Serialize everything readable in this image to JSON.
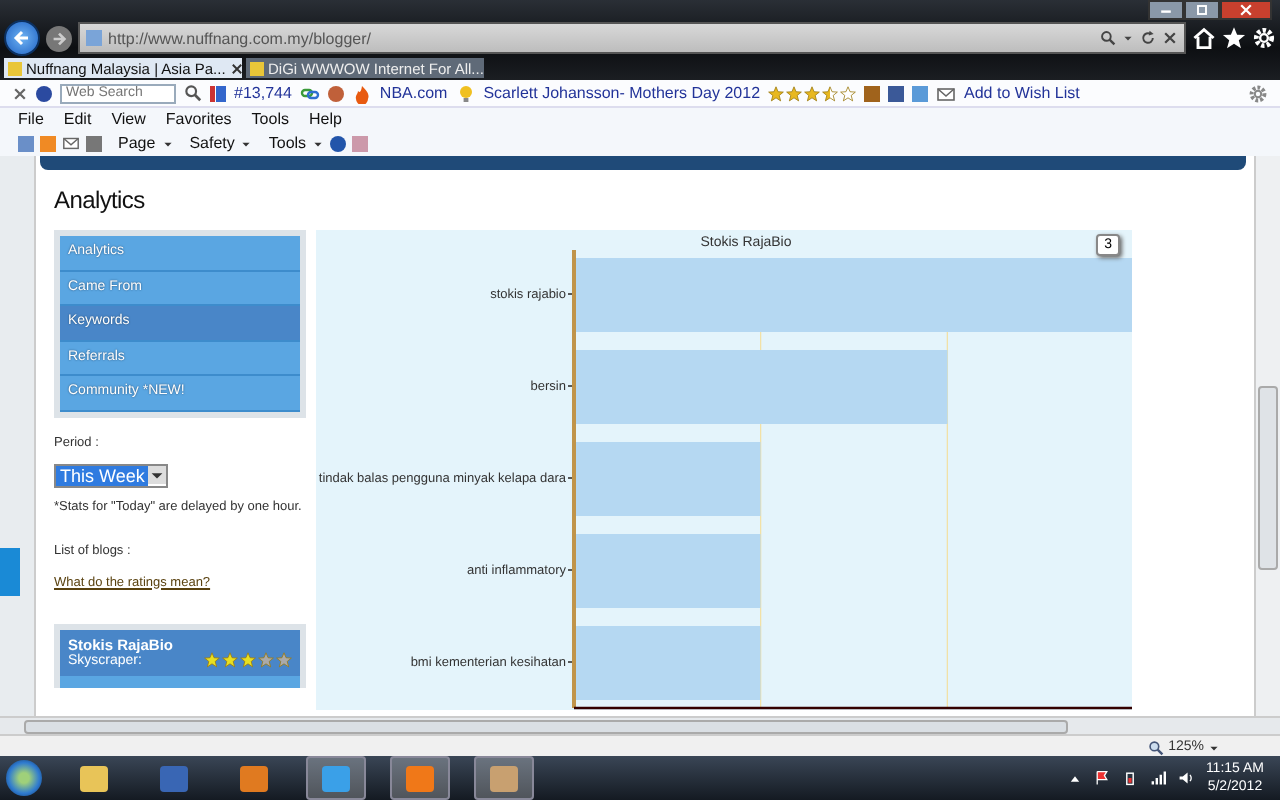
{
  "browser": {
    "address": "http://www.nuffnang.com.my/blogger/",
    "tabs": [
      {
        "label": "Nuffnang Malaysia | Asia Pa...",
        "selected": true
      },
      {
        "label": "DiGi WWWOW Internet For All...",
        "selected": false
      }
    ]
  },
  "toolbar": {
    "search_placeholder": "Web Search",
    "rank": "#13,744",
    "site_link": "NBA.com",
    "news_link": "Scarlett Johansson- Mothers Day 2012",
    "stars": 3.5,
    "wish_list": "Add to Wish List"
  },
  "menu": [
    "File",
    "Edit",
    "View",
    "Favorites",
    "Tools",
    "Help"
  ],
  "command_bar": [
    "Page",
    "Safety",
    "Tools"
  ],
  "page": {
    "heading": "Analytics",
    "nav": [
      {
        "label": "Analytics",
        "selected": false
      },
      {
        "label": "Came From",
        "selected": false
      },
      {
        "label": "Keywords",
        "selected": true
      },
      {
        "label": "Referrals",
        "selected": false
      },
      {
        "label": "Community *NEW!",
        "selected": false
      }
    ],
    "period_label": "Period :",
    "period_value": "This Week",
    "note": "*Stats for \"Today\" are delayed by one hour.",
    "blogs_label": "List of blogs :",
    "ratings_link": "What do the ratings mean?",
    "blog": {
      "name": "Stokis RajaBio",
      "type": "Skyscraper:",
      "stars": 3
    },
    "chart_badge": "3",
    "chart": {
      "title": "Stokis RajaBio",
      "bar_labels": [
        "stokis rajabio",
        "bersin",
        "tindak balas pengguna minyak kelapa dara",
        "anti inflammatory",
        "bmi kementerian kesihatan"
      ]
    }
  },
  "status_bar": {
    "zoom": "125%"
  },
  "taskbar": {
    "time": "11:15 AM",
    "date": "5/2/2012"
  }
}
